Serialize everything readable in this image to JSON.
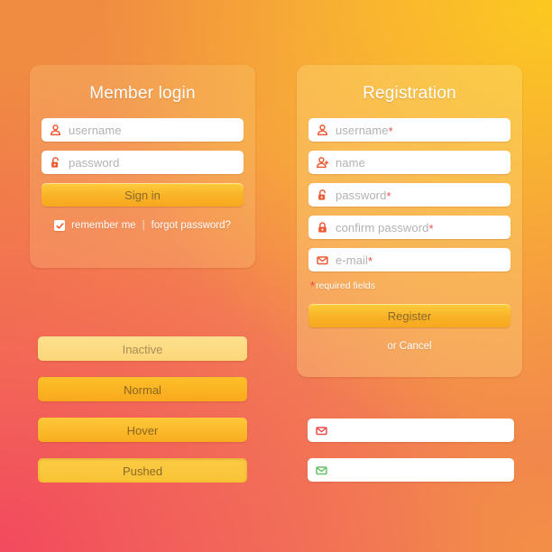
{
  "login": {
    "title": "Member login",
    "fields": [
      {
        "icon": "user-icon",
        "placeholder": "username"
      },
      {
        "icon": "lock-open-icon",
        "placeholder": "password"
      }
    ],
    "submit_label": "Sign in",
    "remember_label": "remember me",
    "separator": "|",
    "forgot_label": "forgot password?",
    "remember_checked": true
  },
  "registration": {
    "title": "Registration",
    "fields": [
      {
        "icon": "user-icon",
        "placeholder": "username",
        "required": true
      },
      {
        "icon": "user-plus-icon",
        "placeholder": "name",
        "required": false
      },
      {
        "icon": "lock-open-icon",
        "placeholder": "password",
        "required": true
      },
      {
        "icon": "lock-closed-icon",
        "placeholder": "confirm password",
        "required": true
      },
      {
        "icon": "envelope-icon",
        "placeholder": "e-mail",
        "required": true
      }
    ],
    "required_note": "required fields",
    "submit_label": "Register",
    "cancel_label": "or Cancel"
  },
  "button_states": [
    {
      "label": "Inactive",
      "state": "inactive"
    },
    {
      "label": "Normal",
      "state": "normal"
    },
    {
      "label": "Hover",
      "state": "hover"
    },
    {
      "label": "Pushed",
      "state": "pushed"
    }
  ],
  "validation_fields": [
    {
      "icon": "envelope-icon",
      "state": "error",
      "value": ""
    },
    {
      "icon": "envelope-icon",
      "state": "valid",
      "value": ""
    }
  ],
  "colors": {
    "accent_orange": "#ef5b35",
    "accent_red": "#ef4d4d",
    "accent_green": "#6abf69",
    "button_yellow": "#f9b227",
    "bg_top_left": "#f08b42",
    "bg_top_right": "#fbc91f",
    "bg_bottom_left": "#f2495e",
    "bg_bottom_right": "#f38f46",
    "placeholder_grey": "#b2b2b2",
    "panel_overlay": "rgba(255,225,150,0.20)"
  }
}
